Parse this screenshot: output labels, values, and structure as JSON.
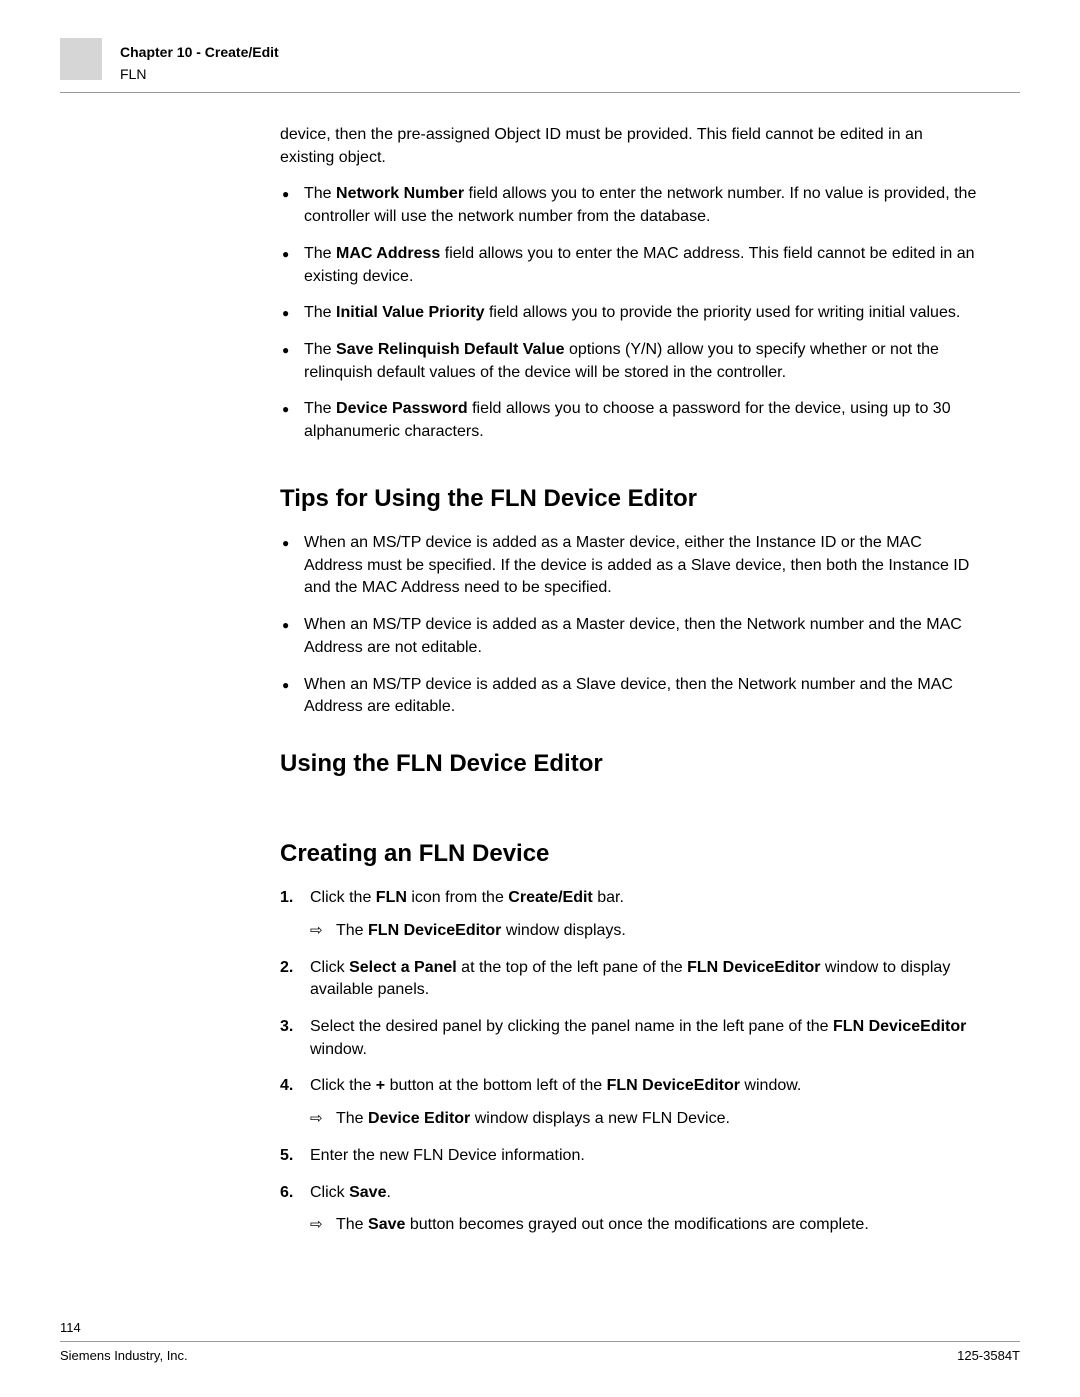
{
  "header": {
    "chapter": "Chapter 10 - Create/Edit",
    "section": "FLN"
  },
  "intro_paragraph": {
    "pre": "device, then the pre-assigned Object ID must be provided. This field cannot be edited in an existing object."
  },
  "top_bullets": [
    {
      "pre": "The ",
      "bold": "Network Number",
      "post": " field allows you to enter the network number. If no value is provided, the controller will use the network number from the database."
    },
    {
      "pre": "The ",
      "bold": "MAC Address",
      "post": " field allows you to enter the MAC address. This field cannot be edited in an existing device."
    },
    {
      "pre": "The ",
      "bold": "Initial Value Priority",
      "post": " field allows you to provide the priority used for writing initial values."
    },
    {
      "pre": "The ",
      "bold": "Save Relinquish Default Value",
      "post": " options (Y/N) allow you to specify whether or not the relinquish default values of the device will be stored in the controller."
    },
    {
      "pre": "The ",
      "bold": "Device Password",
      "post": " field allows you to choose a password for the device, using up to 30 alphanumeric characters."
    }
  ],
  "heading_tips": "Tips for Using the FLN Device Editor",
  "tips_bullets": [
    "When an MS/TP device is added as a Master device, either the Instance ID or the MAC Address must be specified. If the device is added as a Slave device, then both the Instance ID and the MAC Address need to be specified.",
    "When an MS/TP device is added as a Master device, then the Network number and the MAC Address are not editable.",
    "When an MS/TP device is added as a Slave device, then the Network number and the MAC Address are editable."
  ],
  "heading_using": "Using the FLN Device Editor",
  "heading_creating": "Creating an FLN Device",
  "steps": {
    "s1": {
      "pre": "Click the ",
      "b1": "FLN",
      "mid": " icon from the ",
      "b2": "Create/Edit",
      "post": " bar."
    },
    "s1r": {
      "pre": "The ",
      "b1": "FLN DeviceEditor",
      "post": " window displays."
    },
    "s2": {
      "pre": "Click ",
      "b1": "Select a Panel",
      "mid": " at the top of the left pane of the ",
      "b2": "FLN DeviceEditor",
      "post": " window to display available panels."
    },
    "s3": {
      "pre": "Select the desired panel by clicking the panel name in the left pane of the ",
      "b1": "FLN DeviceEditor",
      "post": " window."
    },
    "s4": {
      "pre": "Click the ",
      "b1": "+",
      "mid": " button at the bottom left of the ",
      "b2": "FLN DeviceEditor",
      "post": " window."
    },
    "s4r": {
      "pre": "The ",
      "b1": "Device Editor",
      "post": " window displays a new FLN Device."
    },
    "s5": {
      "text": "Enter the new FLN Device information."
    },
    "s6": {
      "pre": "Click ",
      "b1": "Save",
      "post": "."
    },
    "s6r": {
      "pre": "The ",
      "b1": "Save",
      "post": " button becomes grayed out once the modifications are complete."
    }
  },
  "footer": {
    "page": "114",
    "left": "Siemens Industry, Inc.",
    "right": "125-3584T"
  }
}
